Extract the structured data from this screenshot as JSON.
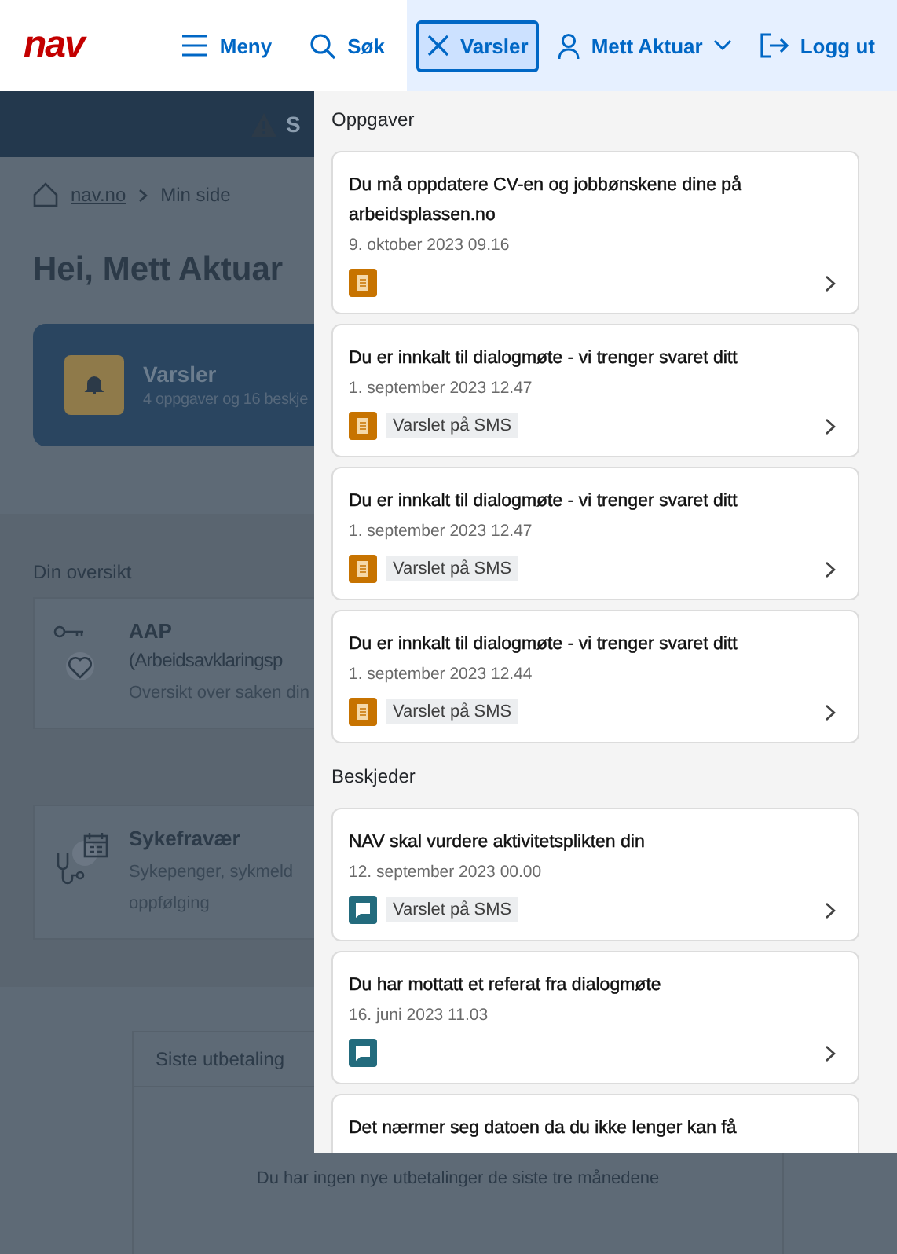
{
  "header": {
    "logo": "nav",
    "nav": [
      {
        "label": "Meny",
        "selected": false
      },
      {
        "label": "Søk",
        "selected": false
      },
      {
        "label": "Varsler",
        "selected": true
      },
      {
        "label": "Mett Aktuar",
        "selected": false
      },
      {
        "label": "Logg ut",
        "selected": false
      }
    ]
  },
  "page": {
    "banner": {
      "text": "S"
    },
    "breadcrumb": [
      "nav.no",
      "Min side"
    ],
    "heading": "Hei, Mett Aktuar",
    "varsler_card": {
      "title": "Varsler",
      "subtitle": "4 oppgaver og 16 beskje"
    },
    "overview_title": "Din oversikt",
    "overview_cards": [
      {
        "title": "AAP",
        "title_line2": "(Arbeidsavklaringsp",
        "subtitle": "Oversikt over saken din"
      },
      {
        "title": "Sykefravær",
        "subtitle": "Sykepenger, sykmeld",
        "subtitle_line2": "oppfølging"
      }
    ],
    "payment": {
      "title": "Siste utbetaling",
      "message": "Du har ingen nye utbetalinger de siste tre månedene"
    }
  },
  "panel": {
    "sections": [
      {
        "title": "Oppgaver",
        "items": [
          {
            "kind": "oppgave",
            "title": "Du må oppdatere CV-en og jobbønskene dine på arbeidsplassen.no",
            "date": "9. oktober 2023 09.16"
          },
          {
            "kind": "oppgave",
            "title": "Du er innkalt til dialogmøte - vi trenger svaret ditt",
            "date": "1. september 2023 12.47",
            "tag": "Varslet på SMS"
          },
          {
            "kind": "oppgave",
            "title": "Du er innkalt til dialogmøte - vi trenger svaret ditt",
            "date": "1. september 2023 12.47",
            "tag": "Varslet på SMS"
          },
          {
            "kind": "oppgave",
            "title": "Du er innkalt til dialogmøte - vi trenger svaret ditt",
            "date": "1. september 2023 12.44",
            "tag": "Varslet på SMS"
          }
        ]
      },
      {
        "title": "Beskjeder",
        "items": [
          {
            "kind": "beskjed",
            "title": "NAV skal vurdere aktivitetsplikten din",
            "date": "12. september 2023 00.00",
            "tag": "Varslet på SMS"
          },
          {
            "kind": "beskjed",
            "title": "Du har mottatt et referat fra dialogmøte",
            "date": "16. juni 2023 11.03"
          },
          {
            "title": "Det nærmer seg datoen da du ikke lenger kan få"
          }
        ]
      }
    ]
  }
}
